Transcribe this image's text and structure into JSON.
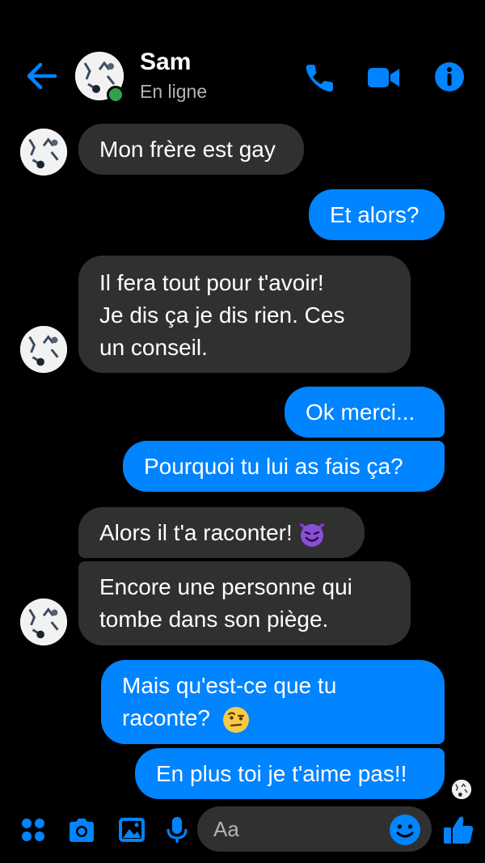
{
  "header": {
    "name": "Sam",
    "status": "En ligne",
    "back_icon": "arrow-left-icon",
    "icons": [
      "phone-icon",
      "video-camera-icon",
      "info-icon"
    ]
  },
  "colors": {
    "accent": "#0084ff",
    "incoming": "#303030",
    "online": "#31a24c",
    "background": "#000000"
  },
  "messages": [
    {
      "from": "contact",
      "lines": [
        "Mon frère est gay"
      ]
    },
    {
      "from": "me",
      "lines": [
        "Et alors?"
      ]
    },
    {
      "from": "contact",
      "lines": [
        "Il fera tout pour t'avoir!",
        "Je dis ça je dis rien. Ces",
        "un conseil."
      ]
    },
    {
      "from": "me",
      "lines": [
        "Ok merci..."
      ]
    },
    {
      "from": "me",
      "lines": [
        "Pourquoi tu lui as fais ça?"
      ]
    },
    {
      "from": "contact",
      "lines": [
        "Alors il t'a raconter!"
      ],
      "emoji": "smiling-devil-emoji"
    },
    {
      "from": "contact",
      "lines": [
        "Encore une personne qui",
        "tombe dans son piège."
      ]
    },
    {
      "from": "me",
      "lines": [
        "Mais qu'est-ce que tu",
        "raconte?"
      ],
      "emoji": "raised-eyebrow-emoji"
    },
    {
      "from": "me",
      "lines": [
        "En plus toi je t'aime pas!!"
      ]
    }
  ],
  "composer": {
    "placeholder": "Aa",
    "icons": [
      "apps-grid-icon",
      "camera-icon",
      "image-icon",
      "microphone-icon",
      "emoji-icon",
      "thumbs-up-icon"
    ]
  }
}
